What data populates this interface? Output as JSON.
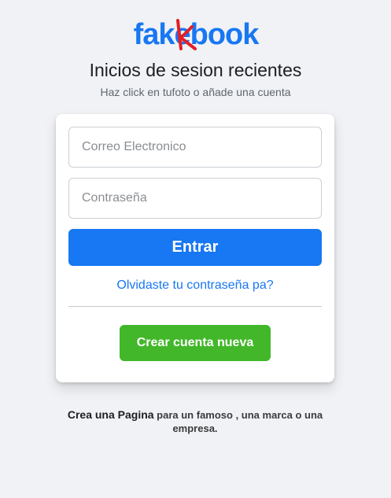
{
  "brand": {
    "logo_text": "fakebook",
    "logo_color": "#1877f2",
    "logo_mark_color": "#e41e26"
  },
  "header": {
    "title": "Inicios de sesion recientes",
    "subtitle": "Haz click en tufoto o añade una cuenta"
  },
  "login_form": {
    "email_placeholder": "Correo Electronico",
    "email_value": "",
    "password_placeholder": "Contraseña",
    "password_value": "",
    "submit_label": "Entrar",
    "forgot_label": "Olvidaste tu contraseña pa?",
    "create_label": "Crear cuenta nueva"
  },
  "footer": {
    "create_page_link": "Crea una Pagina",
    "create_page_text": " para un famoso , una marca o una empresa."
  },
  "colors": {
    "background": "#f0f2f5",
    "primary": "#1877f2",
    "success": "#42b72a"
  }
}
